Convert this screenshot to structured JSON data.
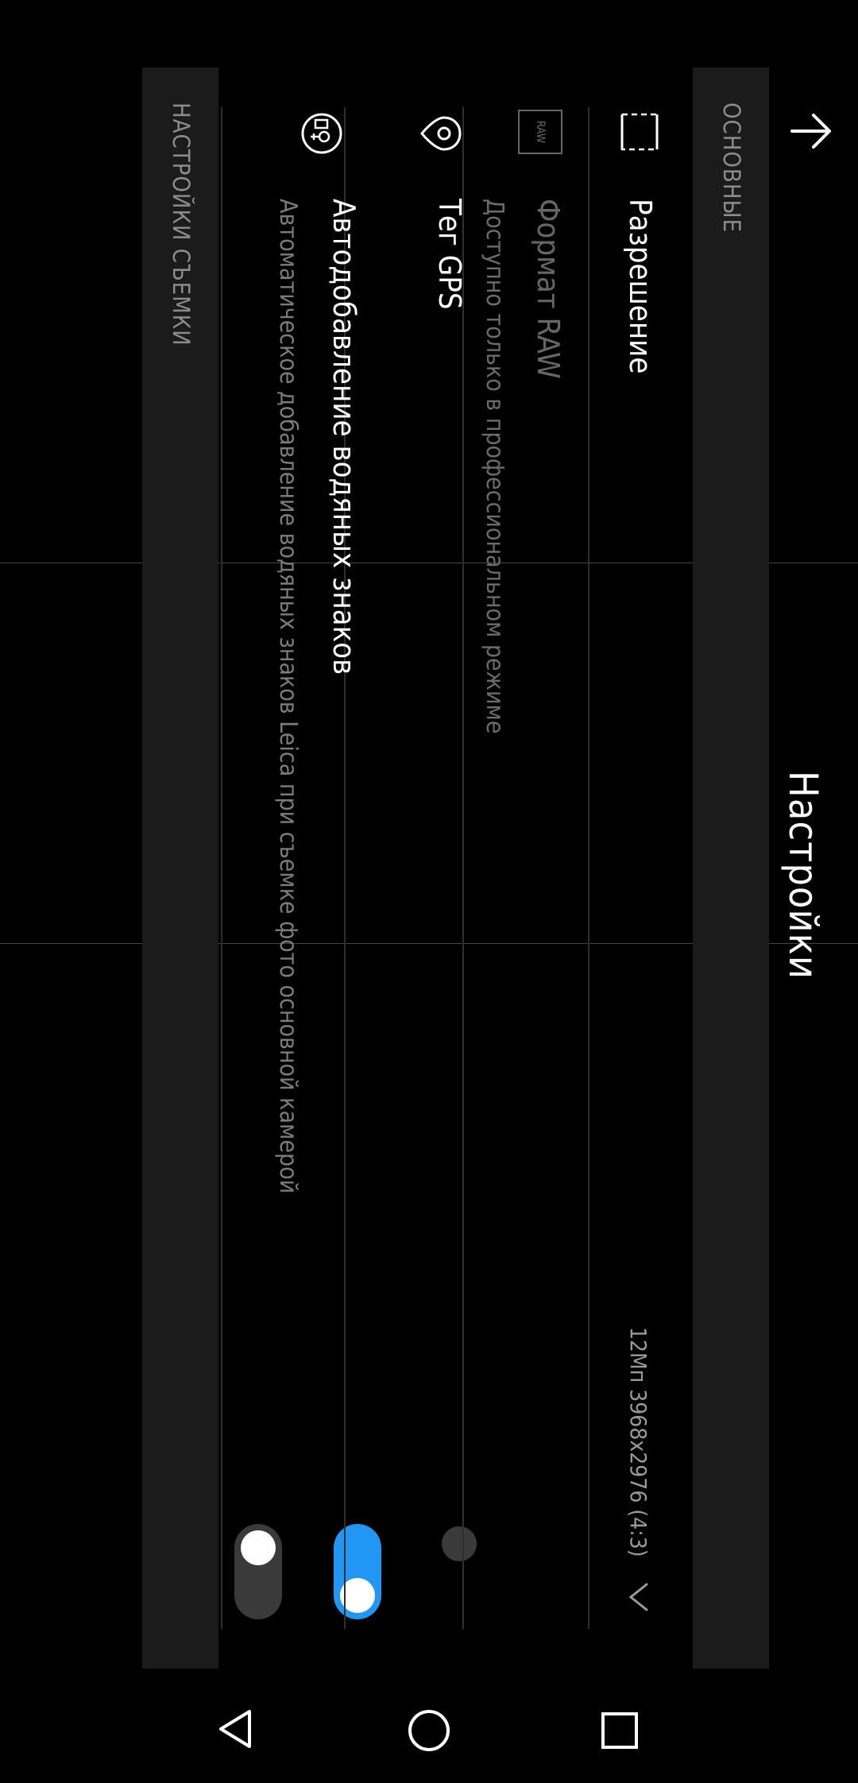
{
  "header": {
    "title": "Настройки",
    "back_icon": "arrow-up-icon"
  },
  "sections": {
    "basic": "ОСНОВНЫЕ",
    "shooting": "НАСТРОЙКИ СЪЕМКИ"
  },
  "settings": {
    "resolution": {
      "label": "Разрешение",
      "value": "12Мп 3968x2976 (4:3)",
      "icon": "frame-icon",
      "dropdown_icon": "chevron-down-icon"
    },
    "raw": {
      "label": "Формат RAW",
      "description": "Доступно только в профессиональном режиме",
      "icon": "raw-icon",
      "icon_text": "RAW",
      "enabled": false
    },
    "gps": {
      "label": "Тег GPS",
      "icon": "location-pin-icon",
      "on": true
    },
    "watermark": {
      "label": "Автодобавление водяных знаков",
      "description": "Автоматическое добавление водяных знаков Leica при съемке фото основной камерой",
      "icon": "watermark-icon",
      "on": false
    }
  },
  "colors": {
    "accent": "#2196f3",
    "toggle_off": "#3a3a3a",
    "section_bg": "#1b1b1b"
  },
  "navbar": {
    "back_icon": "nav-back-icon",
    "home_icon": "nav-home-icon",
    "recents_icon": "nav-recents-icon"
  }
}
